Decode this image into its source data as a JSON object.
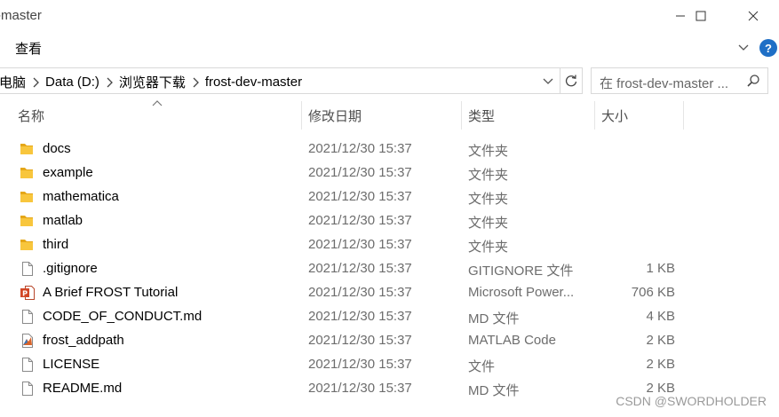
{
  "window": {
    "title": "-master",
    "controls": {
      "minimize": "minimize-icon",
      "maximize": "maximize-icon",
      "close": "close-icon"
    }
  },
  "ribbon": {
    "view_tab": "查看",
    "help": "?"
  },
  "address": {
    "breadcrumbs": [
      "电脑",
      "Data (D:)",
      "浏览器下载",
      "frost-dev-master"
    ]
  },
  "search": {
    "placeholder": "在 frost-dev-master ..."
  },
  "columns": {
    "name": "名称",
    "date": "修改日期",
    "type": "类型",
    "size": "大小"
  },
  "files": [
    {
      "name": "docs",
      "date": "2021/12/30 15:37",
      "type": "文件夹",
      "size": "",
      "icon": "folder"
    },
    {
      "name": "example",
      "date": "2021/12/30 15:37",
      "type": "文件夹",
      "size": "",
      "icon": "folder"
    },
    {
      "name": "mathematica",
      "date": "2021/12/30 15:37",
      "type": "文件夹",
      "size": "",
      "icon": "folder"
    },
    {
      "name": "matlab",
      "date": "2021/12/30 15:37",
      "type": "文件夹",
      "size": "",
      "icon": "folder"
    },
    {
      "name": "third",
      "date": "2021/12/30 15:37",
      "type": "文件夹",
      "size": "",
      "icon": "folder"
    },
    {
      "name": ".gitignore",
      "date": "2021/12/30 15:37",
      "type": "GITIGNORE 文件",
      "size": "1 KB",
      "icon": "file"
    },
    {
      "name": "A Brief FROST Tutorial",
      "date": "2021/12/30 15:37",
      "type": "Microsoft Power...",
      "size": "706 KB",
      "icon": "ppt"
    },
    {
      "name": "CODE_OF_CONDUCT.md",
      "date": "2021/12/30 15:37",
      "type": "MD 文件",
      "size": "4 KB",
      "icon": "file"
    },
    {
      "name": "frost_addpath",
      "date": "2021/12/30 15:37",
      "type": "MATLAB Code",
      "size": "2 KB",
      "icon": "matlab"
    },
    {
      "name": "LICENSE",
      "date": "2021/12/30 15:37",
      "type": "文件",
      "size": "2 KB",
      "icon": "file"
    },
    {
      "name": "README.md",
      "date": "2021/12/30 15:37",
      "type": "MD 文件",
      "size": "2 KB",
      "icon": "file"
    }
  ],
  "colors": {
    "folder": "#f8c63d",
    "help": "#1f6fc6",
    "ppt": "#d24726",
    "secondary_text": "#6d6d6d"
  },
  "watermark": "CSDN @SWORDHOLDER"
}
